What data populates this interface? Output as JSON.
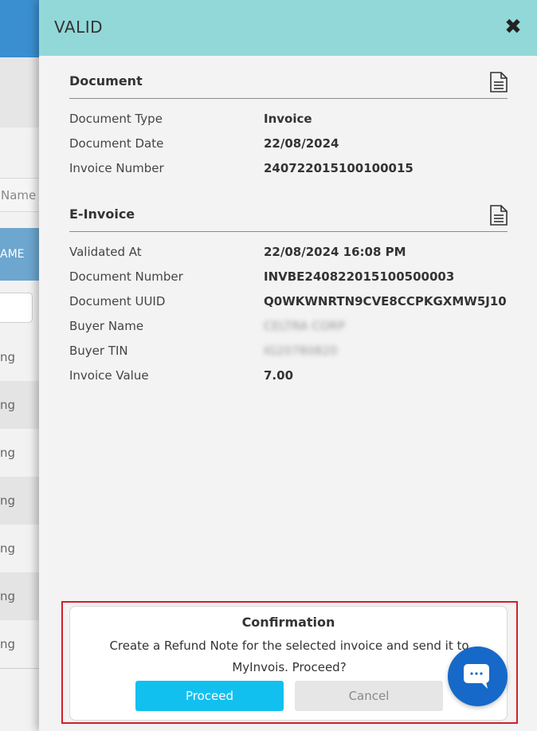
{
  "background": {
    "column_header": "Name",
    "selected_row_text": "AME",
    "row_texts": [
      "ng",
      "ng",
      "ng",
      "ng",
      "ng",
      "ng",
      "ng"
    ]
  },
  "panel": {
    "title": "VALID",
    "close_icon": "close-icon",
    "document_section": {
      "title": "Document",
      "icon": "document-icon",
      "fields": [
        {
          "label": "Document Type",
          "value": "Invoice"
        },
        {
          "label": "Document Date",
          "value": "22/08/2024"
        },
        {
          "label": "Invoice Number",
          "value": "240722015100100015"
        }
      ]
    },
    "einvoice_section": {
      "title": "E-Invoice",
      "icon": "document-icon",
      "fields": [
        {
          "label": "Validated At",
          "value": "22/08/2024 16:08 PM"
        },
        {
          "label": "Document Number",
          "value": "INVBE240822015100500003"
        },
        {
          "label": "Document UUID",
          "value": "Q0WKWNRTN9CVE8CCPKGXMW5J10"
        },
        {
          "label": "Buyer Name",
          "value": "CELTRA CORP"
        },
        {
          "label": "Buyer TIN",
          "value": "IG20780820"
        },
        {
          "label": "Invoice Value",
          "value": "7.00"
        }
      ]
    }
  },
  "confirmation": {
    "title": "Confirmation",
    "message": "Create a Refund Note for the selected invoice and send it to MyInvois. Proceed?",
    "proceed_label": "Proceed",
    "cancel_label": "Cancel"
  },
  "chat": {
    "icon": "chat-icon"
  },
  "colors": {
    "header_bg": "#92d8d8",
    "proceed_bg": "#12c0f0",
    "chat_bg": "#1669c8",
    "highlight_border": "#d0202a"
  }
}
